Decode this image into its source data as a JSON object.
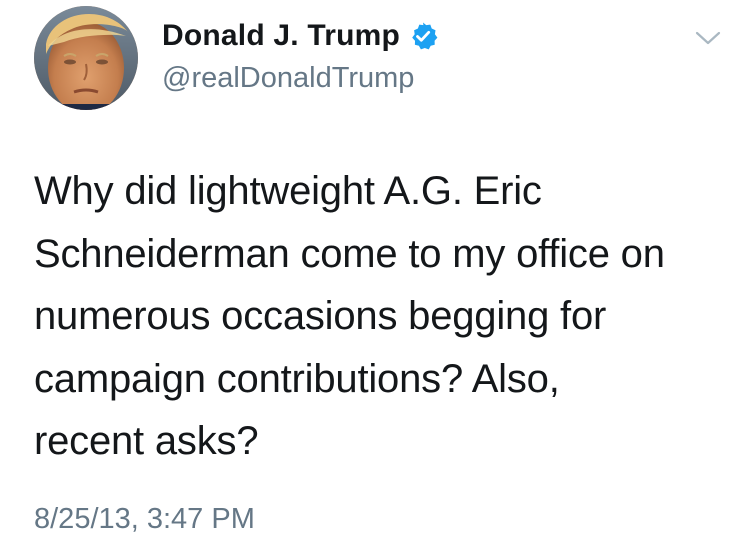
{
  "author": {
    "display_name": "Donald J. Trump",
    "handle": "@realDonaldTrump",
    "verified": true,
    "verified_color": "#1da1f2"
  },
  "tweet": {
    "lines": [
      "Why did lightweight A.G. Eric",
      "Schneiderman come to my office on",
      "numerous occasions begging for",
      "campaign contributions? Also,",
      "recent asks?"
    ],
    "timestamp": "8/25/13, 3:47 PM"
  },
  "icons": {
    "avatar": "profile-photo",
    "verified": "verified-badge-icon",
    "menu": "chevron-down-icon"
  },
  "colors": {
    "text": "#14171a",
    "secondary": "#657786",
    "chevron": "#aab8c2"
  }
}
